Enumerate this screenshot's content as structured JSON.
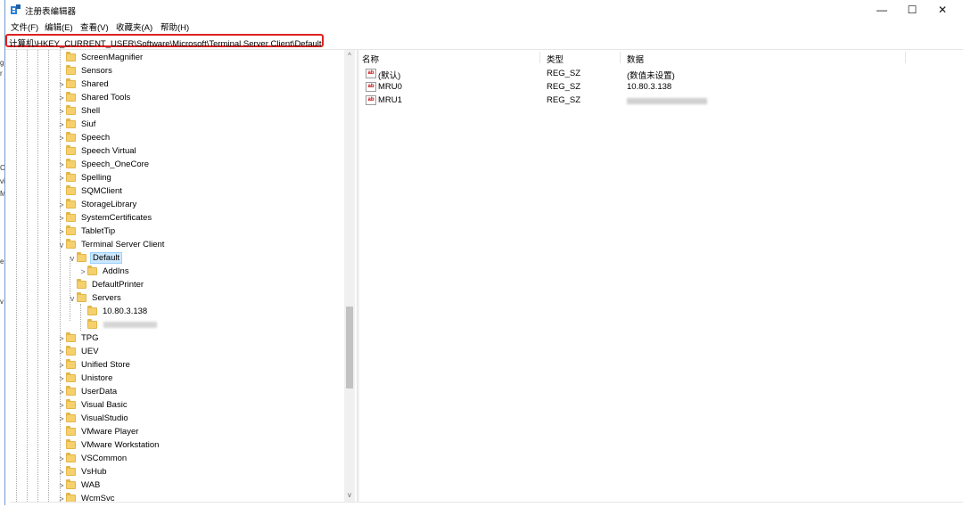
{
  "window": {
    "title": "注册表编辑器",
    "controls": {
      "minimize": "—",
      "maximize": "☐",
      "close": "✕"
    }
  },
  "menu": [
    "文件(F)",
    "编辑(E)",
    "查看(V)",
    "收藏夹(A)",
    "帮助(H)"
  ],
  "address": "计算机\\HKEY_CURRENT_USER\\Software\\Microsoft\\Terminal Server Client\\Default",
  "tree": {
    "items": [
      {
        "label": "ScreenMagnifier",
        "expander": ""
      },
      {
        "label": "Sensors",
        "expander": ""
      },
      {
        "label": "Shared",
        "expander": ">"
      },
      {
        "label": "Shared Tools",
        "expander": ">"
      },
      {
        "label": "Shell",
        "expander": ">"
      },
      {
        "label": "Siuf",
        "expander": ">"
      },
      {
        "label": "Speech",
        "expander": ">"
      },
      {
        "label": "Speech Virtual",
        "expander": ""
      },
      {
        "label": "Speech_OneCore",
        "expander": ">"
      },
      {
        "label": "Spelling",
        "expander": ">"
      },
      {
        "label": "SQMClient",
        "expander": ""
      },
      {
        "label": "StorageLibrary",
        "expander": ">"
      },
      {
        "label": "SystemCertificates",
        "expander": ">"
      },
      {
        "label": "TabletTip",
        "expander": ">"
      },
      {
        "label": "Terminal Server Client",
        "expander": "v"
      },
      {
        "label": "Default",
        "expander": "v"
      },
      {
        "label": "AddIns",
        "expander": ">"
      },
      {
        "label": "DefaultPrinter",
        "expander": ""
      },
      {
        "label": "Servers",
        "expander": "v"
      },
      {
        "label": "10.80.3.138",
        "expander": ""
      },
      {
        "label": "",
        "expander": ""
      },
      {
        "label": "TPG",
        "expander": ">"
      },
      {
        "label": "UEV",
        "expander": ">"
      },
      {
        "label": "Unified Store",
        "expander": ">"
      },
      {
        "label": "Unistore",
        "expander": ">"
      },
      {
        "label": "UserData",
        "expander": ">"
      },
      {
        "label": "Visual Basic",
        "expander": ">"
      },
      {
        "label": "VisualStudio",
        "expander": ">"
      },
      {
        "label": "VMware Player",
        "expander": ""
      },
      {
        "label": "VMware Workstation",
        "expander": ""
      },
      {
        "label": "VSCommon",
        "expander": ">"
      },
      {
        "label": "VsHub",
        "expander": ">"
      },
      {
        "label": "WAB",
        "expander": ">"
      },
      {
        "label": "WcmSvc",
        "expander": ">"
      }
    ]
  },
  "scroll": {
    "up": "^",
    "down": "v"
  },
  "list": {
    "columns": [
      "名称",
      "类型",
      "数据"
    ],
    "rows": [
      {
        "icon": "ab",
        "name": "(默认)",
        "type": "REG_SZ",
        "data": "(数值未设置)"
      },
      {
        "icon": "ab",
        "name": "MRU0",
        "type": "REG_SZ",
        "data": "10.80.3.138"
      },
      {
        "icon": "ab",
        "name": "MRU1",
        "type": "REG_SZ",
        "data": ""
      }
    ]
  },
  "left_edge": [
    "g",
    "r",
    "C",
    "vi",
    "M",
    "e",
    "v"
  ]
}
